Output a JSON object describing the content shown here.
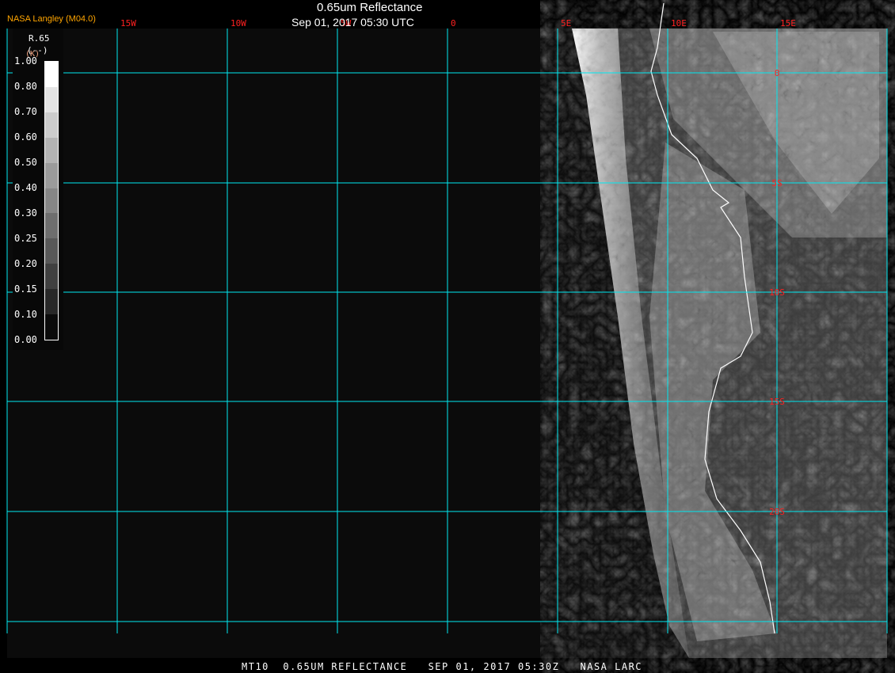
{
  "header": {
    "title": "0.65um Reflectance",
    "subtitle": "Sep 01, 2017 05:30 UTC",
    "credit": "NASA Langley (M04.0)"
  },
  "footer": "MT10  0.65UM REFLECTANCE   SEP 01, 2017 05:30Z   NASA LARC",
  "legend": {
    "name": "R.65",
    "unit": "(--)",
    "unit2": "(K)",
    "labels": [
      "1.00",
      "0.80",
      "0.70",
      "0.60",
      "0.50",
      "0.40",
      "0.30",
      "0.25",
      "0.20",
      "0.15",
      "0.10",
      "0.00"
    ],
    "colors": [
      "#ffffff",
      "#e4e4e4",
      "#cccccc",
      "#b3b3b3",
      "#9b9b9b",
      "#868686",
      "#6e6e6e",
      "#585858",
      "#404040",
      "#282828",
      "#0b0b0b"
    ]
  },
  "grid": {
    "lon_labels": [
      "15W",
      "10W",
      "5W",
      "0",
      "5E",
      "10E",
      "15E"
    ],
    "lat_labels": [
      "0",
      "5S",
      "10S",
      "15S",
      "20S"
    ],
    "line_color": "#00e8f0",
    "label_color": "#ff2020",
    "coast_color": "#ffffff"
  }
}
